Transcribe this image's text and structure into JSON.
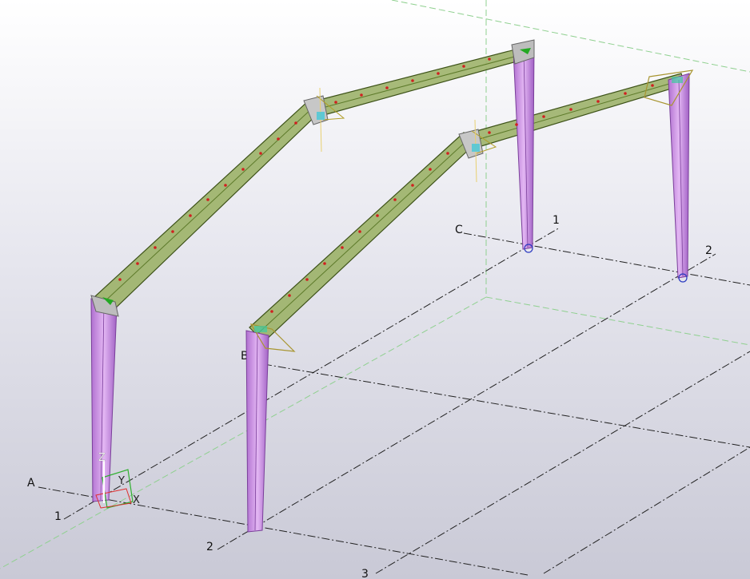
{
  "viewport": {
    "grid_labels": {
      "a": "A",
      "b": "B",
      "c": "C",
      "n1_front": "1",
      "n2_front": "2",
      "n3_front": "3",
      "n1_back": "1",
      "n2_back": "2"
    },
    "coordinate_axes": {
      "x": "X",
      "y": "Y",
      "z": "Z"
    }
  },
  "colors": {
    "column": "#c98ee0",
    "column_edge": "#7a3f9a",
    "rafter": "#9db36a",
    "rafter_edge": "#3d5218",
    "gridline": "#222222",
    "workplane": "#8fd08f",
    "axis_x": "#e03030",
    "axis_y": "#30b030",
    "axis_z": "#ffffff"
  }
}
